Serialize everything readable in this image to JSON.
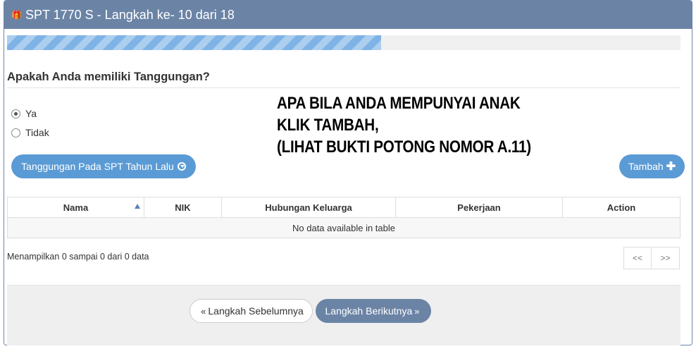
{
  "header": {
    "icon": "gift-icon",
    "title": "SPT 1770 S - Langkah ke- 10 dari 18"
  },
  "progress": {
    "fraction": 0.555,
    "color": "#7fb3e6"
  },
  "question": "Apakah Anda memiliki Tanggungan?",
  "radios": [
    {
      "label": "Ya",
      "checked": true
    },
    {
      "label": "Tidak",
      "checked": false
    }
  ],
  "annotation": {
    "lines": [
      "APA BILA ANDA MEMPUNYAI ANAK",
      "KLIK TAMBAH,",
      "(LIHAT BUKTI POTONG NOMOR A.11)"
    ]
  },
  "buttons": {
    "previous_year": "Tanggungan Pada SPT Tahun Lalu",
    "add": "Tambah",
    "prev_step": "Langkah Sebelumnya",
    "next_step": "Langkah Berikutnya"
  },
  "table": {
    "columns": [
      "Nama",
      "NIK",
      "Hubungan Keluarga",
      "Pekerjaan",
      "Action"
    ],
    "empty_message": "No data available in table"
  },
  "info": "Menampilkan 0 sampai 0 dari 0 data",
  "pager": {
    "first": "<<",
    "last": ">>"
  },
  "colors": {
    "header_bg": "#6b84a6",
    "primary_button": "#5b9bd5",
    "next_button": "#6b84a6"
  }
}
